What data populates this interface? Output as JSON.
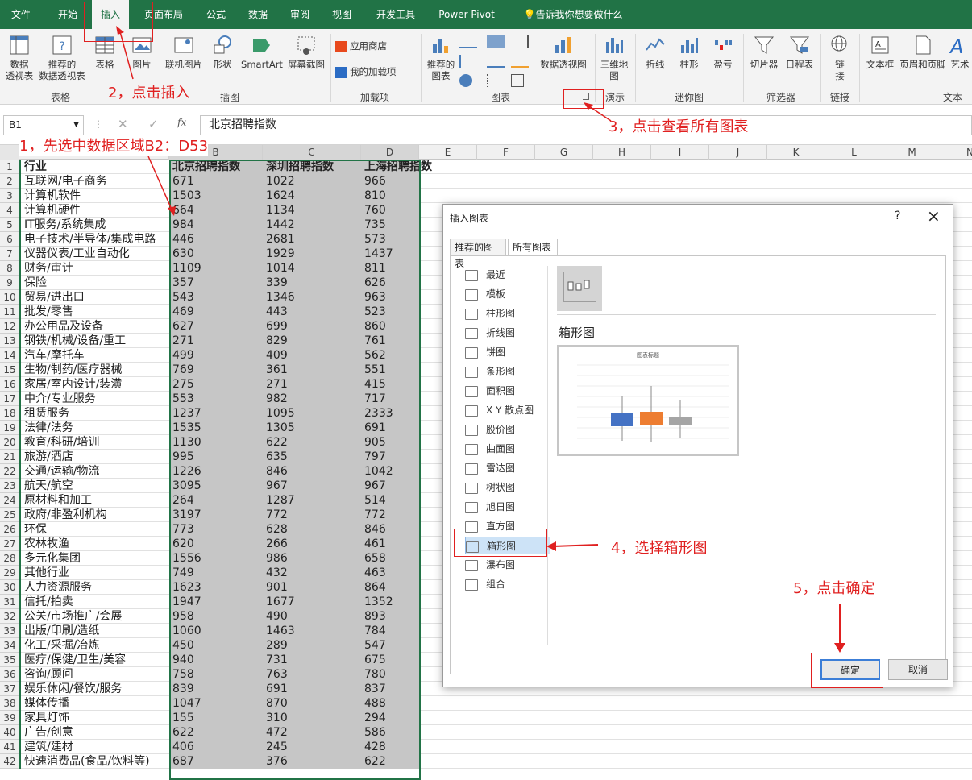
{
  "tabs": [
    "文件",
    "开始",
    "插入",
    "页面布局",
    "公式",
    "数据",
    "审阅",
    "视图",
    "开发工具",
    "Power Pivot",
    "告诉我你想要做什么"
  ],
  "ribbon": {
    "buttons": {
      "pivot": "数据\n透视表",
      "rec_pivot": "推荐的\n数据透视表",
      "table": "表格",
      "picture": "图片",
      "online_pic": "联机图片",
      "shapes": "形状",
      "smartart": "SmartArt",
      "screenshot": "屏幕截图",
      "store": "应用商店",
      "myaddins": "我的加载项",
      "rec_charts": "推荐的\n图表",
      "pivot_chart": "数据透视图",
      "map3d": "三维地\n图",
      "line": "折线",
      "column": "柱形",
      "winloss": "盈亏",
      "slicer": "切片器",
      "timeline": "日程表",
      "link": "链\n接",
      "textbox": "文本框",
      "headerfooter": "页眉和页脚",
      "wordart": "艺术"
    },
    "groups": [
      "表格",
      "插图",
      "加载项",
      "图表",
      "演示",
      "迷你图",
      "筛选器",
      "链接",
      "文本"
    ]
  },
  "formula": {
    "namebox": "B1",
    "content": "北京招聘指数"
  },
  "columns": [
    "A",
    "B",
    "C",
    "D",
    "E",
    "F",
    "G",
    "H",
    "I",
    "J",
    "K",
    "L",
    "M",
    "N"
  ],
  "rows": [
    [
      "行业",
      "北京招聘指数",
      "深圳招聘指数",
      "上海招聘指数"
    ],
    [
      "互联网/电子商务",
      "671",
      "1022",
      "966"
    ],
    [
      "计算机软件",
      "1503",
      "1624",
      "810"
    ],
    [
      "计算机硬件",
      "664",
      "1134",
      "760"
    ],
    [
      "IT服务/系统集成",
      "984",
      "1442",
      "735"
    ],
    [
      "电子技术/半导体/集成电路",
      "446",
      "2681",
      "573"
    ],
    [
      "仪器仪表/工业自动化",
      "630",
      "1929",
      "1437"
    ],
    [
      "财务/审计",
      "1109",
      "1014",
      "811"
    ],
    [
      "保险",
      "357",
      "339",
      "626"
    ],
    [
      "贸易/进出口",
      "543",
      "1346",
      "963"
    ],
    [
      "批发/零售",
      "469",
      "443",
      "523"
    ],
    [
      "办公用品及设备",
      "627",
      "699",
      "860"
    ],
    [
      "钢铁/机械/设备/重工",
      "271",
      "829",
      "761"
    ],
    [
      "汽车/摩托车",
      "499",
      "409",
      "562"
    ],
    [
      "生物/制药/医疗器械",
      "769",
      "361",
      "551"
    ],
    [
      "家居/室内设计/装潢",
      "275",
      "271",
      "415"
    ],
    [
      "中介/专业服务",
      "553",
      "982",
      "717"
    ],
    [
      "租赁服务",
      "1237",
      "1095",
      "2333"
    ],
    [
      "法律/法务",
      "1535",
      "1305",
      "691"
    ],
    [
      "教育/科研/培训",
      "1130",
      "622",
      "905"
    ],
    [
      "旅游/酒店",
      "995",
      "635",
      "797"
    ],
    [
      "交通/运输/物流",
      "1226",
      "846",
      "1042"
    ],
    [
      "航天/航空",
      "3095",
      "967",
      "967"
    ],
    [
      "原材料和加工",
      "264",
      "1287",
      "514"
    ],
    [
      "政府/非盈利机构",
      "3197",
      "772",
      "772"
    ],
    [
      "环保",
      "773",
      "628",
      "846"
    ],
    [
      "农林牧渔",
      "620",
      "266",
      "461"
    ],
    [
      "多元化集团",
      "1556",
      "986",
      "658"
    ],
    [
      "其他行业",
      "749",
      "432",
      "463"
    ],
    [
      "人力资源服务",
      "1623",
      "901",
      "864"
    ],
    [
      "信托/拍卖",
      "1947",
      "1677",
      "1352"
    ],
    [
      "公关/市场推广/会展",
      "958",
      "490",
      "893"
    ],
    [
      "出版/印刷/造纸",
      "1060",
      "1463",
      "784"
    ],
    [
      "化工/采掘/冶炼",
      "450",
      "289",
      "547"
    ],
    [
      "医疗/保健/卫生/美容",
      "940",
      "731",
      "675"
    ],
    [
      "咨询/顾问",
      "758",
      "763",
      "780"
    ],
    [
      "娱乐休闲/餐饮/服务",
      "839",
      "691",
      "837"
    ],
    [
      "媒体传播",
      "1047",
      "870",
      "488"
    ],
    [
      "家具灯饰",
      "155",
      "310",
      "294"
    ],
    [
      "广告/创意",
      "622",
      "472",
      "586"
    ],
    [
      "建筑/建材",
      "406",
      "245",
      "428"
    ],
    [
      "快速消费品(食品/饮料等)",
      "687",
      "376",
      "622"
    ]
  ],
  "annotations": {
    "step1": "1，先选中数据区域B2：D53",
    "step2": "2，点击插入",
    "step3": "3，点击查看所有图表",
    "step4": "4，选择箱形图",
    "step5": "5，点击确定"
  },
  "dialog": {
    "title": "插入图表",
    "help": "?",
    "close": "×",
    "tab_recommended": "推荐的图表",
    "tab_all": "所有图表",
    "chart_types": [
      "最近",
      "模板",
      "柱形图",
      "折线图",
      "饼图",
      "条形图",
      "面积图",
      "X Y 散点图",
      "股价图",
      "曲面图",
      "雷达图",
      "树状图",
      "旭日图",
      "直方图",
      "箱形图",
      "瀑布图",
      "组合"
    ],
    "selected_type": "箱形图",
    "preview_title": "图表标题",
    "ok": "确定",
    "cancel": "取消",
    "accent_colors": [
      "#4472c4",
      "#ed7d31",
      "#a5a5a5"
    ]
  }
}
